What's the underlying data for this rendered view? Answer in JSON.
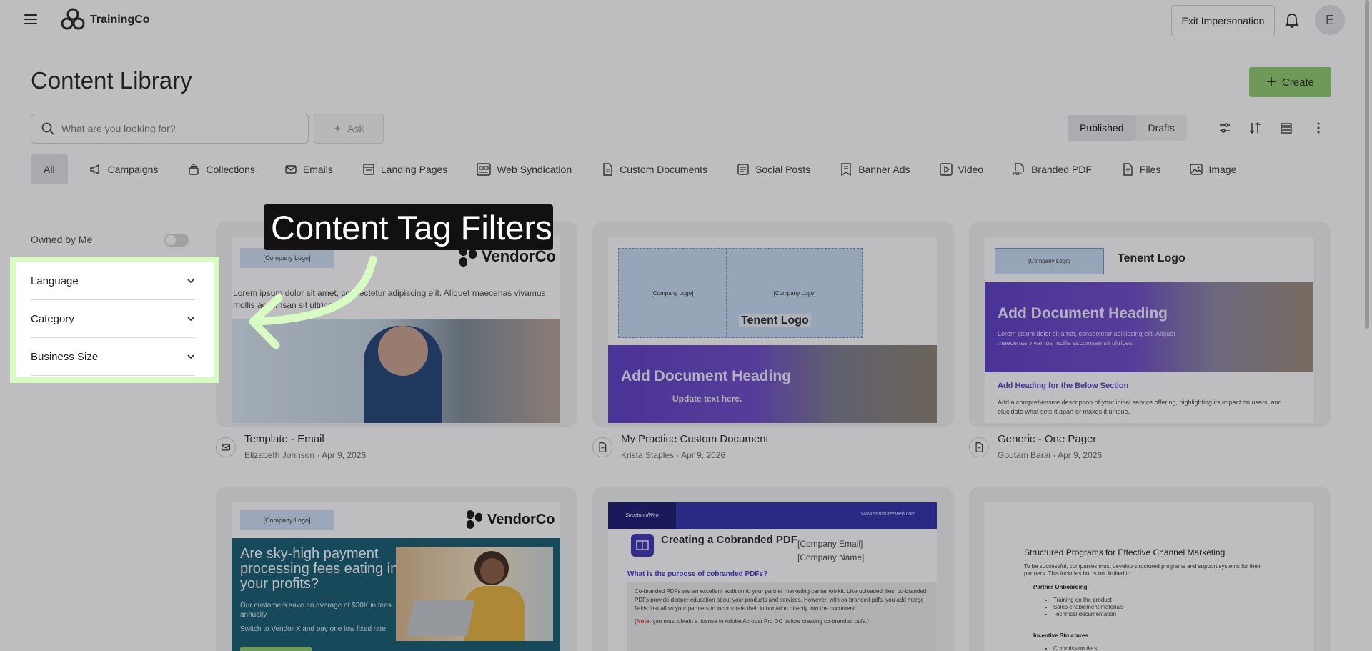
{
  "app": {
    "name": "TrainingCo",
    "exit_label": "Exit Impersonation",
    "avatar_initial": "E"
  },
  "page": {
    "title": "Content Library",
    "create_label": "Create"
  },
  "search": {
    "placeholder": "What are you looking for?",
    "ask_label": "Ask"
  },
  "view": {
    "published_label": "Published",
    "drafts_label": "Drafts"
  },
  "tabs": [
    "All",
    "Campaigns",
    "Collections",
    "Emails",
    "Landing Pages",
    "Web Syndication",
    "Custom Documents",
    "Social Posts",
    "Banner Ads",
    "Video",
    "Branded PDF",
    "Files",
    "Image"
  ],
  "sidebar": {
    "owned_label": "Owned by Me",
    "filters": [
      "Language",
      "Category",
      "Business Size"
    ]
  },
  "annotation": {
    "text": "Content Tag Filters"
  },
  "cards": [
    {
      "title": "Template - Email",
      "author": "Elizabeth Johnson",
      "date": "Apr 9, 2026",
      "thumb": {
        "logo": "[Company Logo]",
        "vendor": "VendorCo",
        "body": "Lorem ipsum dolor sit amet, consectetur adipiscing elit. Aliquet maecenas vivamus mollis accumsan sit ultrices."
      }
    },
    {
      "title": "My Practice Custom Document",
      "author": "Krista Staples",
      "date": "Apr 9, 2026",
      "thumb": {
        "logo1": "[Company Logo]",
        "logo2": "[Company Logo]",
        "tenant": "Tenent Logo",
        "heading": "Add Document Heading",
        "sub": "Update text here."
      }
    },
    {
      "title": "Generic - One Pager",
      "author": "Goutam Barai",
      "date": "Apr 9, 2026",
      "thumb": {
        "logo": "[Company Logo]",
        "tenant": "Tenent Logo",
        "heading": "Add Document Heading",
        "body": "Lorem ipsum dolor sit amet, consectetur adipiscing elit. Aliquet maecenas vivamus mollis accumsan sit ultrices.",
        "section": "Add Heading for the Below Section",
        "section_body": "Add a comprehensive description of your initial service offering, highlighting its impact on users, and elucidate what sets it apart or makes it unique."
      }
    },
    {
      "thumb": {
        "logo": "[Company Logo]",
        "vendor": "VendorCo",
        "headline": "Are sky-high payment processing fees eating in your profits?",
        "body1": "Our customers save an average of $30K in fees annually",
        "body2": "Switch to Vendor X and pay one low fixed rate."
      }
    },
    {
      "thumb": {
        "brand": "StructuredWeb",
        "url": "www.structuredweb.com",
        "heading": "Creating a Cobranded PDF",
        "email": "[Company Email]",
        "name": "[Company Name]",
        "question": "What is the purpose of cobranded PDFs?",
        "body": "Co-branded PDFs are an excellent addition to your partner marketing center toolkit. Like uploaded files, co-branded PDFs provide deeper education about your products and services. However, with co-branded pdfs, you add merge fields that allow your partners to incorporate their information directly into the document.",
        "note_label": "Note:",
        "note": " you must obtain a license to Adobe Acrobat Pro DC before creating co-branded pdfs."
      }
    },
    {
      "thumb": {
        "heading": "Structured Programs for Effective Channel Marketing",
        "intro": "To be successful, companies must develop structured programs and support systems for their partners. This includes but is not limited to:",
        "section1": "Partner Onboarding",
        "items": [
          "Training on the product",
          "Sales enablement materials",
          "Technical documentation"
        ],
        "section2": "Incentive Structures",
        "item2": "Commission tiers"
      }
    }
  ],
  "colors": {
    "accent": "#8ecb6a",
    "highlight": "#d7fbc3",
    "purple": "#6a3fc0",
    "teal": "#0f5a6e"
  }
}
